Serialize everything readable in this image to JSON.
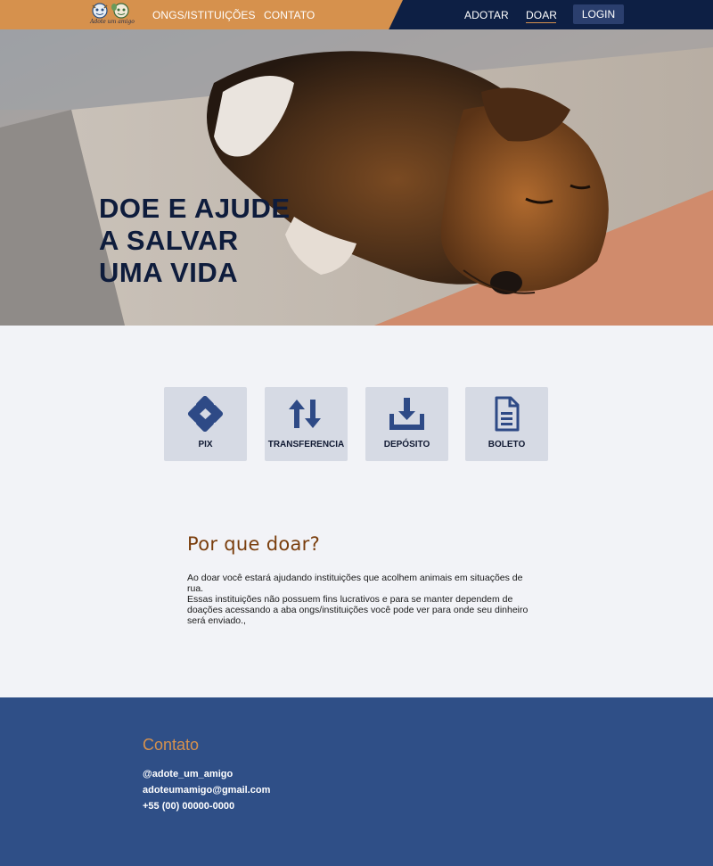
{
  "nav": {
    "logo_text": "Adote um amigo",
    "links_left": [
      "ONGS/ISTITUIÇÕES",
      "CONTATO"
    ],
    "links_right": [
      "ADOTAR",
      "DOAR"
    ],
    "login_label": "LOGIN"
  },
  "hero": {
    "title": "DOE E AJUDE\nA SALVAR\nUMA VIDA"
  },
  "payment_options": [
    {
      "label": "PIX",
      "icon": "pix-icon"
    },
    {
      "label": "TRANSFERENCIA",
      "icon": "transfer-arrows-icon"
    },
    {
      "label": "DEPÓSITO",
      "icon": "download-tray-icon"
    },
    {
      "label": "BOLETO",
      "icon": "document-icon"
    }
  ],
  "why": {
    "title": "Por que doar?",
    "paragraphs": [
      "Ao doar você estará ajudando instituições que acolhem animais em situações de rua.",
      "Essas instituições não possuem fins lucrativos e para se manter dependem de doações acessando a aba ongs/instituições você pode ver para onde seu dinheiro será enviado.,"
    ]
  },
  "footer": {
    "title": "Contato",
    "instagram": "@adote_um_amigo",
    "email": "adoteumamigo@gmail.com",
    "phone": "+55 (00) 00000-0000"
  },
  "colors": {
    "nav_dark": "#0d1f44",
    "nav_orange": "#d6914d",
    "accent_blue": "#2f4f87",
    "icon_blue": "#2e4a86",
    "card_bg": "#d6dae4",
    "title_brown": "#7a3e0d"
  }
}
